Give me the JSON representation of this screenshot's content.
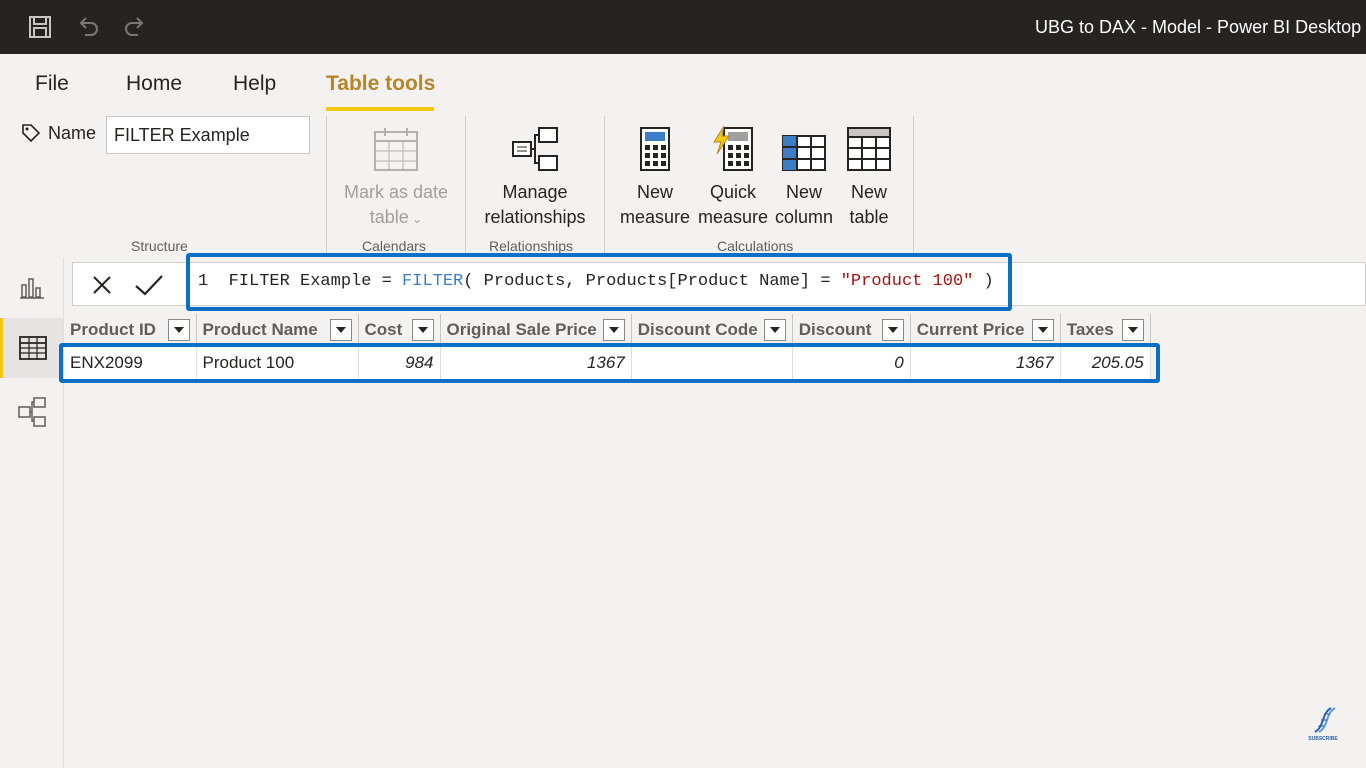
{
  "window": {
    "title": "UBG to DAX - Model - Power BI Desktop"
  },
  "tabs": [
    {
      "label": "File"
    },
    {
      "label": "Home"
    },
    {
      "label": "Help"
    },
    {
      "label": "Table tools",
      "active": true
    }
  ],
  "ribbon": {
    "structure": {
      "name_label": "Name",
      "name_value": "FILTER Example",
      "group_label": "Structure"
    },
    "calendars": {
      "mark_as_date_line1": "Mark as date",
      "mark_as_date_line2": "table",
      "group_label": "Calendars"
    },
    "relationships": {
      "manage_line1": "Manage",
      "manage_line2": "relationships",
      "group_label": "Relationships"
    },
    "calculations": {
      "new_measure_line1": "New",
      "new_measure_line2": "measure",
      "quick_measure_line1": "Quick",
      "quick_measure_line2": "measure",
      "new_column_line1": "New",
      "new_column_line2": "column",
      "new_table_line1": "New",
      "new_table_line2": "table",
      "group_label": "Calculations"
    }
  },
  "formula": {
    "line_number": "1",
    "part1": "FILTER Example = ",
    "func": "FILTER",
    "part2": "( Products, Products[Product Name] = ",
    "string": "\"Product 100\"",
    "part3": " )"
  },
  "table": {
    "columns": [
      "Product ID",
      "Product Name",
      "Cost",
      "Original Sale Price",
      "Discount Code",
      "Discount",
      "Current Price",
      "Taxes"
    ],
    "rows": [
      {
        "product_id": "ENX2099",
        "product_name": "Product 100",
        "cost": "984",
        "original_sale_price": "1367",
        "discount_code": "",
        "discount": "0",
        "current_price": "1367",
        "taxes": "205.05"
      }
    ]
  },
  "colors": {
    "accent": "#f2c811",
    "active_tab": "#b5862a",
    "highlight": "#0b6fc6",
    "dax_keyword": "#3b7dc6",
    "dax_string": "#a31515"
  },
  "brand": {
    "caption": "SUBSCRIBE"
  }
}
